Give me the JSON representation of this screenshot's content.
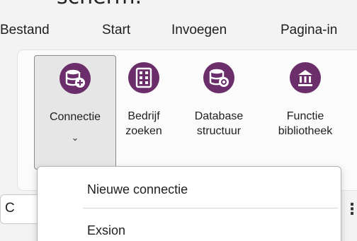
{
  "top_partial_text": "scherm.",
  "menu": {
    "tabs": [
      "Bestand",
      "Start",
      "Invoegen",
      "Pagina-in"
    ]
  },
  "ribbon": {
    "buttons": [
      {
        "icon": "database-add-icon",
        "line1": "Connectie",
        "line2": "",
        "has_dropdown": true,
        "active": true
      },
      {
        "icon": "building-icon",
        "line1": "Bedrijf",
        "line2": "zoeken",
        "has_dropdown": false,
        "active": false
      },
      {
        "icon": "database-settings-icon",
        "line1": "Database",
        "line2": "structuur",
        "has_dropdown": false,
        "active": false
      },
      {
        "icon": "library-icon",
        "line1": "Functie",
        "line2": "bibliotheek",
        "has_dropdown": false,
        "active": false
      }
    ],
    "dropdown_chevron": "⌄"
  },
  "dropdown": {
    "items": [
      "Nieuwe connectie",
      "Exsion"
    ]
  },
  "bottom_bar": {
    "search_partial": "C",
    "more_glyph": "⋮"
  },
  "colors": {
    "icon_purple": "#6b2e6a",
    "active_bg": "#e6e6e6",
    "ribbon_bg": "#fbfbfb"
  }
}
